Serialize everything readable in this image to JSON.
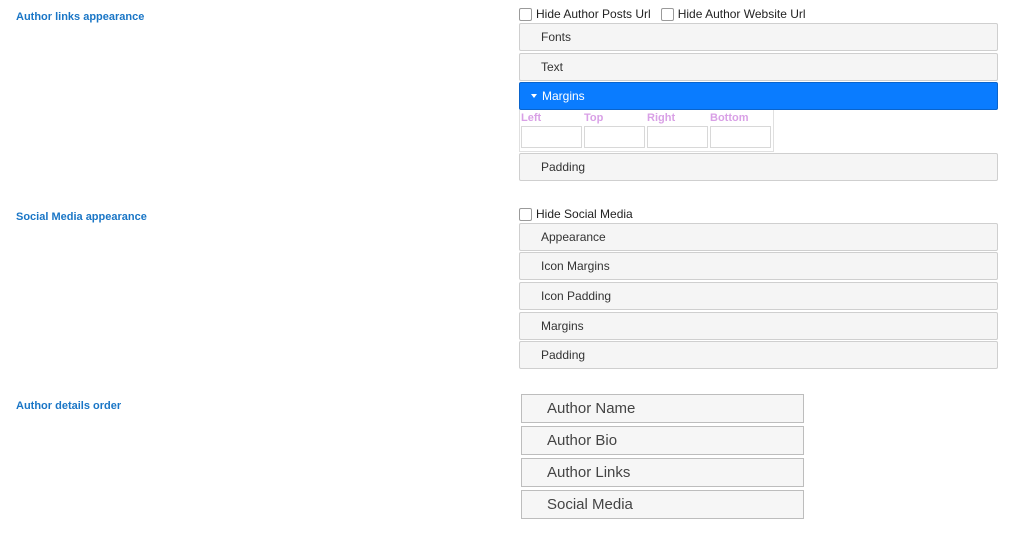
{
  "author_links": {
    "label": "Author links appearance",
    "checkboxes": [
      {
        "label": "Hide Author Posts Url",
        "checked": false
      },
      {
        "label": "Hide Author Website Url",
        "checked": false
      }
    ],
    "panels": {
      "fonts": "Fonts",
      "text": "Text",
      "margins": "Margins",
      "padding": "Padding"
    },
    "active_panel": "Margins",
    "margins_fields": {
      "left": {
        "label": "Left",
        "value": ""
      },
      "top": {
        "label": "Top",
        "value": ""
      },
      "right": {
        "label": "Right",
        "value": ""
      },
      "bottom": {
        "label": "Bottom",
        "value": ""
      }
    }
  },
  "social_media": {
    "label": "Social Media appearance",
    "checkbox": {
      "label": "Hide Social Media",
      "checked": false
    },
    "panels": [
      "Appearance",
      "Icon Margins",
      "Icon Padding",
      "Margins",
      "Padding"
    ]
  },
  "author_details_order": {
    "label": "Author details order",
    "items": [
      "Author Name",
      "Author Bio",
      "Author Links",
      "Social Media"
    ]
  },
  "colors": {
    "section_label": "#1a76c6",
    "active_panel_bg": "#0a7cff",
    "margin_label": "#d9a0e6"
  }
}
